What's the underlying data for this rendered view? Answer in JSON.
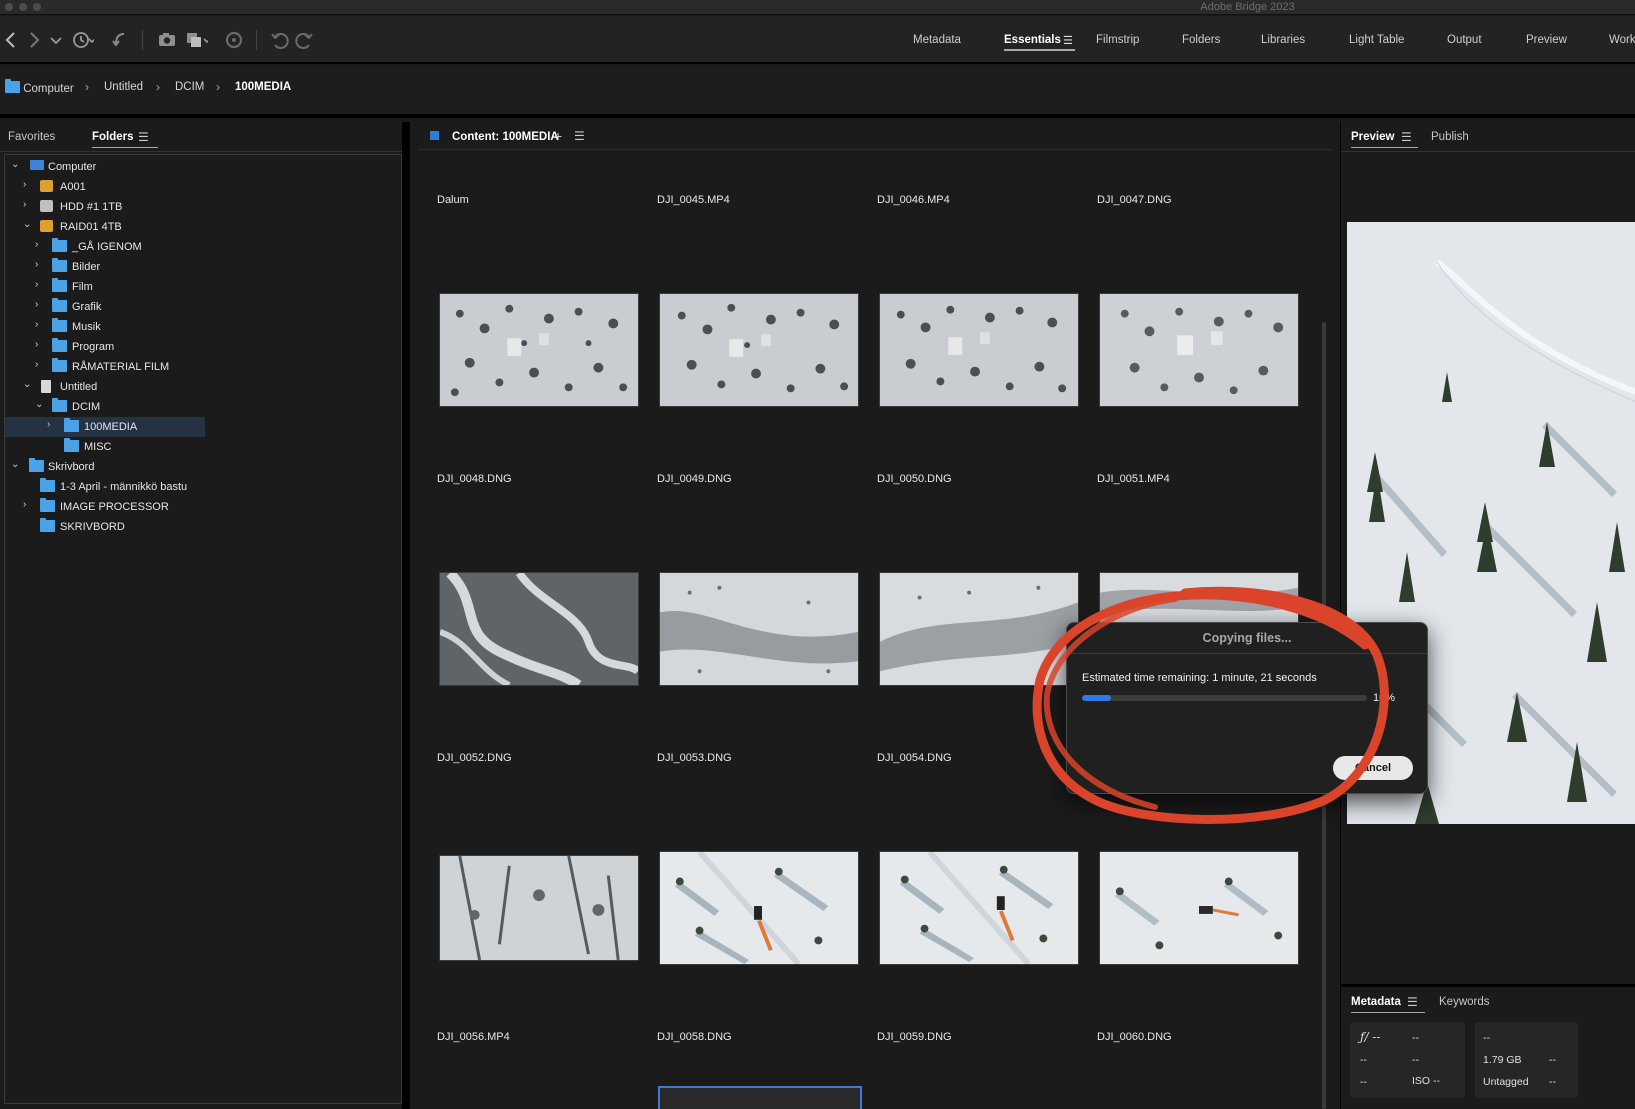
{
  "app": {
    "title": "Adobe Bridge 2023"
  },
  "workspaces": [
    {
      "label": "Metadata"
    },
    {
      "label": "Essentials"
    },
    {
      "label": "Filmstrip"
    },
    {
      "label": "Folders"
    },
    {
      "label": "Libraries"
    },
    {
      "label": "Light Table"
    },
    {
      "label": "Output"
    },
    {
      "label": "Preview"
    },
    {
      "label": "Work"
    }
  ],
  "breadcrumb": [
    "Computer",
    "Untitled",
    "DCIM",
    "100MEDIA"
  ],
  "left_panel": {
    "tabs": [
      "Favorites",
      "Folders"
    ],
    "tree": [
      {
        "label": "Computer"
      },
      {
        "label": "A001"
      },
      {
        "label": "HDD #1 1TB"
      },
      {
        "label": "RAID01 4TB"
      },
      {
        "label": "_GÅ IGENOM"
      },
      {
        "label": "Bilder"
      },
      {
        "label": "Film"
      },
      {
        "label": "Grafik"
      },
      {
        "label": "Musik"
      },
      {
        "label": "Program"
      },
      {
        "label": "RÅMATERIAL FILM"
      },
      {
        "label": "Untitled"
      },
      {
        "label": "DCIM"
      },
      {
        "label": "100MEDIA"
      },
      {
        "label": "MISC"
      },
      {
        "label": "Skrivbord"
      },
      {
        "label": "1-3 April - männikkö bastu"
      },
      {
        "label": "IMAGE PROCESSOR"
      },
      {
        "label": "SKRIVBORD"
      }
    ]
  },
  "content": {
    "title": "Content: 100MEDIA",
    "items": [
      {
        "name": "Dalum"
      },
      {
        "name": "DJI_0045.MP4"
      },
      {
        "name": "DJI_0046.MP4"
      },
      {
        "name": "DJI_0047.DNG"
      },
      {
        "name": "DJI_0048.DNG"
      },
      {
        "name": "DJI_0049.DNG"
      },
      {
        "name": "DJI_0050.DNG"
      },
      {
        "name": "DJI_0051.MP4"
      },
      {
        "name": "DJI_0052.DNG"
      },
      {
        "name": "DJI_0053.DNG"
      },
      {
        "name": "DJI_0054.DNG"
      },
      {
        "name": "DJI_0056.MP4"
      },
      {
        "name": "DJI_0058.DNG"
      },
      {
        "name": "DJI_0059.DNG"
      },
      {
        "name": "DJI_0060.DNG"
      }
    ]
  },
  "right_panel": {
    "tabs": [
      "Preview",
      "Publish"
    ],
    "meta_tabs": [
      "Metadata",
      "Keywords"
    ],
    "metadata": {
      "aperture": "ƒ/ --",
      "shutter": "--",
      "r2c1": "--",
      "r2c2": "--",
      "r3c1": "--",
      "iso": "ISO --",
      "b_r1": "--",
      "size": "1.79 GB",
      "size_v": "--",
      "tag": "Untagged",
      "tag_v": "--"
    }
  },
  "dialog": {
    "title": "Copying files...",
    "estimate": "Estimated time remaining: 1 minute, 21 seconds",
    "progress": 0.1,
    "percent_label": "10%",
    "cancel": "Cancel"
  },
  "colors": {
    "accent": "#2f7ae5",
    "folder": "#4aa3e8",
    "annotation": "#d9442a"
  }
}
